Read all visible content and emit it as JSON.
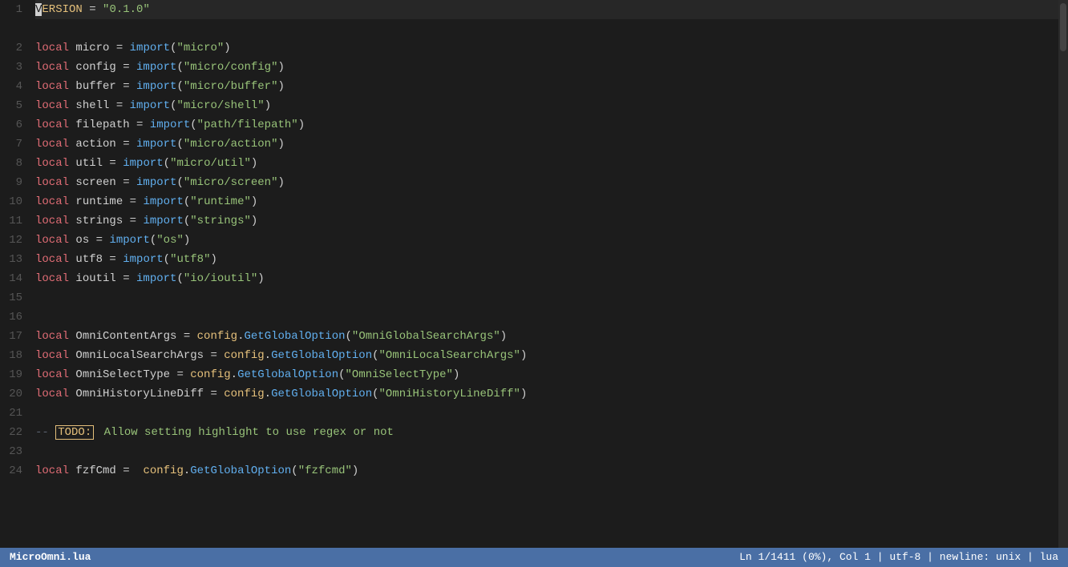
{
  "editor": {
    "filename": "MicroOmni.lua",
    "status_right": "Ln 1/1411 (0%), Col 1  |  utf-8  |  newline: unix  |  lua"
  },
  "lines": [
    {
      "num": "1",
      "content": "VERSION = \"0.1.0\"",
      "tokens": [
        {
          "t": "var",
          "v": "VERSION"
        },
        {
          "t": "op",
          "v": " = "
        },
        {
          "t": "str",
          "v": "\"0.1.0\""
        }
      ]
    },
    {
      "num": "",
      "content": ""
    },
    {
      "num": "2",
      "content": "local micro = import(\"micro\")",
      "tokens": [
        {
          "t": "kw",
          "v": "local"
        },
        {
          "t": "op",
          "v": " micro = "
        },
        {
          "t": "fn",
          "v": "import"
        },
        {
          "t": "op",
          "v": "("
        },
        {
          "t": "str",
          "v": "\"micro\""
        },
        {
          "t": "op",
          "v": ")"
        }
      ]
    },
    {
      "num": "3",
      "content": "local config = import(\"micro/config\")",
      "tokens": [
        {
          "t": "kw",
          "v": "local"
        },
        {
          "t": "op",
          "v": " config = "
        },
        {
          "t": "fn",
          "v": "import"
        },
        {
          "t": "op",
          "v": "("
        },
        {
          "t": "str",
          "v": "\"micro/config\""
        },
        {
          "t": "op",
          "v": ")"
        }
      ]
    },
    {
      "num": "4",
      "content": "local buffer = import(\"micro/buffer\")",
      "tokens": [
        {
          "t": "kw",
          "v": "local"
        },
        {
          "t": "op",
          "v": " buffer = "
        },
        {
          "t": "fn",
          "v": "import"
        },
        {
          "t": "op",
          "v": "("
        },
        {
          "t": "str",
          "v": "\"micro/buffer\""
        },
        {
          "t": "op",
          "v": ")"
        }
      ]
    },
    {
      "num": "5",
      "content": "local shell = import(\"micro/shell\")",
      "tokens": [
        {
          "t": "kw",
          "v": "local"
        },
        {
          "t": "op",
          "v": " shell = "
        },
        {
          "t": "fn",
          "v": "import"
        },
        {
          "t": "op",
          "v": "("
        },
        {
          "t": "str",
          "v": "\"micro/shell\""
        },
        {
          "t": "op",
          "v": ")"
        }
      ]
    },
    {
      "num": "6",
      "content": "local filepath = import(\"path/filepath\")",
      "tokens": [
        {
          "t": "kw",
          "v": "local"
        },
        {
          "t": "op",
          "v": " filepath = "
        },
        {
          "t": "fn",
          "v": "import"
        },
        {
          "t": "op",
          "v": "("
        },
        {
          "t": "str",
          "v": "\"path/filepath\""
        },
        {
          "t": "op",
          "v": ")"
        }
      ]
    },
    {
      "num": "7",
      "content": "local action = import(\"micro/action\")",
      "tokens": [
        {
          "t": "kw",
          "v": "local"
        },
        {
          "t": "op",
          "v": " action = "
        },
        {
          "t": "fn",
          "v": "import"
        },
        {
          "t": "op",
          "v": "("
        },
        {
          "t": "str",
          "v": "\"micro/action\""
        },
        {
          "t": "op",
          "v": ")"
        }
      ]
    },
    {
      "num": "8",
      "content": "local util = import(\"micro/util\")",
      "tokens": [
        {
          "t": "kw",
          "v": "local"
        },
        {
          "t": "op",
          "v": " util = "
        },
        {
          "t": "fn",
          "v": "import"
        },
        {
          "t": "op",
          "v": "("
        },
        {
          "t": "str",
          "v": "\"micro/util\""
        },
        {
          "t": "op",
          "v": ")"
        }
      ]
    },
    {
      "num": "9",
      "content": "local screen = import(\"micro/screen\")",
      "tokens": [
        {
          "t": "kw",
          "v": "local"
        },
        {
          "t": "op",
          "v": " screen = "
        },
        {
          "t": "fn",
          "v": "import"
        },
        {
          "t": "op",
          "v": "("
        },
        {
          "t": "str",
          "v": "\"micro/screen\""
        },
        {
          "t": "op",
          "v": ")"
        }
      ]
    },
    {
      "num": "10",
      "content": "local runtime = import(\"runtime\")",
      "tokens": [
        {
          "t": "kw",
          "v": "local"
        },
        {
          "t": "op",
          "v": " runtime = "
        },
        {
          "t": "fn",
          "v": "import"
        },
        {
          "t": "op",
          "v": "("
        },
        {
          "t": "str",
          "v": "\"runtime\""
        },
        {
          "t": "op",
          "v": ")"
        }
      ]
    },
    {
      "num": "11",
      "content": "local strings = import(\"strings\")",
      "tokens": [
        {
          "t": "kw",
          "v": "local"
        },
        {
          "t": "op",
          "v": " strings = "
        },
        {
          "t": "fn",
          "v": "import"
        },
        {
          "t": "op",
          "v": "("
        },
        {
          "t": "str",
          "v": "\"strings\""
        },
        {
          "t": "op",
          "v": ")"
        }
      ]
    },
    {
      "num": "12",
      "content": "local os = import(\"os\")",
      "tokens": [
        {
          "t": "kw",
          "v": "local"
        },
        {
          "t": "op",
          "v": " os = "
        },
        {
          "t": "fn",
          "v": "import"
        },
        {
          "t": "op",
          "v": "("
        },
        {
          "t": "str",
          "v": "\"os\""
        },
        {
          "t": "op",
          "v": ")"
        }
      ]
    },
    {
      "num": "13",
      "content": "local utf8 = import(\"utf8\")",
      "tokens": [
        {
          "t": "kw",
          "v": "local"
        },
        {
          "t": "op",
          "v": " utf8 = "
        },
        {
          "t": "fn",
          "v": "import"
        },
        {
          "t": "op",
          "v": "("
        },
        {
          "t": "str",
          "v": "\"utf8\""
        },
        {
          "t": "op",
          "v": ")"
        }
      ]
    },
    {
      "num": "14",
      "content": "local ioutil = import(\"io/ioutil\")",
      "tokens": [
        {
          "t": "kw",
          "v": "local"
        },
        {
          "t": "op",
          "v": " ioutil = "
        },
        {
          "t": "fn",
          "v": "import"
        },
        {
          "t": "op",
          "v": "("
        },
        {
          "t": "str",
          "v": "\"io/ioutil\""
        },
        {
          "t": "op",
          "v": ")"
        }
      ],
      "current": true
    },
    {
      "num": "15",
      "content": ""
    },
    {
      "num": "16",
      "content": ""
    },
    {
      "num": "17",
      "content": "local OmniContentArgs = config.GetGlobalOption(\"OmniGlobalSearchArgs\")",
      "tokens": [
        {
          "t": "kw",
          "v": "local"
        },
        {
          "t": "op",
          "v": " OmniContentArgs = "
        },
        {
          "t": "var",
          "v": "config"
        },
        {
          "t": "op",
          "v": "."
        },
        {
          "t": "fn",
          "v": "GetGlobalOption"
        },
        {
          "t": "op",
          "v": "("
        },
        {
          "t": "str",
          "v": "\"OmniGlobalSearchArgs\""
        },
        {
          "t": "op",
          "v": ")"
        }
      ]
    },
    {
      "num": "18",
      "content": "local OmniLocalSearchArgs = config.GetGlobalOption(\"OmniLocalSearchArgs\")",
      "tokens": [
        {
          "t": "kw",
          "v": "local"
        },
        {
          "t": "op",
          "v": " OmniLocalSearchArgs = "
        },
        {
          "t": "var",
          "v": "config"
        },
        {
          "t": "op",
          "v": "."
        },
        {
          "t": "fn",
          "v": "GetGlobalOption"
        },
        {
          "t": "op",
          "v": "("
        },
        {
          "t": "str",
          "v": "\"OmniLocalSearchArgs\""
        },
        {
          "t": "op",
          "v": ")"
        }
      ]
    },
    {
      "num": "19",
      "content": "local OmniSelectType = config.GetGlobalOption(\"OmniSelectType\")",
      "tokens": [
        {
          "t": "kw",
          "v": "local"
        },
        {
          "t": "op",
          "v": " OmniSelectType = "
        },
        {
          "t": "var",
          "v": "config"
        },
        {
          "t": "op",
          "v": "."
        },
        {
          "t": "fn",
          "v": "GetGlobalOption"
        },
        {
          "t": "op",
          "v": "("
        },
        {
          "t": "str",
          "v": "\"OmniSelectType\""
        },
        {
          "t": "op",
          "v": ")"
        }
      ]
    },
    {
      "num": "20",
      "content": "local OmniHistoryLineDiff = config.GetGlobalOption(\"OmniHistoryLineDiff\")",
      "tokens": [
        {
          "t": "kw",
          "v": "local"
        },
        {
          "t": "op",
          "v": " OmniHistoryLineDiff = "
        },
        {
          "t": "var",
          "v": "config"
        },
        {
          "t": "op",
          "v": "."
        },
        {
          "t": "fn",
          "v": "GetGlobalOption"
        },
        {
          "t": "op",
          "v": "("
        },
        {
          "t": "str",
          "v": "\"OmniHistoryLineDiff\""
        },
        {
          "t": "op",
          "v": ")"
        }
      ]
    },
    {
      "num": "21",
      "content": ""
    },
    {
      "num": "22",
      "content": "-- TODO: Allow setting highlight to use regex or not",
      "todo": true
    },
    {
      "num": "23",
      "content": ""
    },
    {
      "num": "24",
      "content": "local fzfCmd =  config.GetGlobalOption(\"fzfcmd\")",
      "tokens": [
        {
          "t": "kw",
          "v": "local"
        },
        {
          "t": "op",
          "v": " fzfCmd =  "
        },
        {
          "t": "var",
          "v": "config"
        },
        {
          "t": "op",
          "v": "."
        },
        {
          "t": "fn",
          "v": "GetGlobalOption"
        },
        {
          "t": "op",
          "v": "("
        },
        {
          "t": "str",
          "v": "\"fzfcmd\""
        },
        {
          "t": "op",
          "v": ")"
        }
      ]
    }
  ]
}
